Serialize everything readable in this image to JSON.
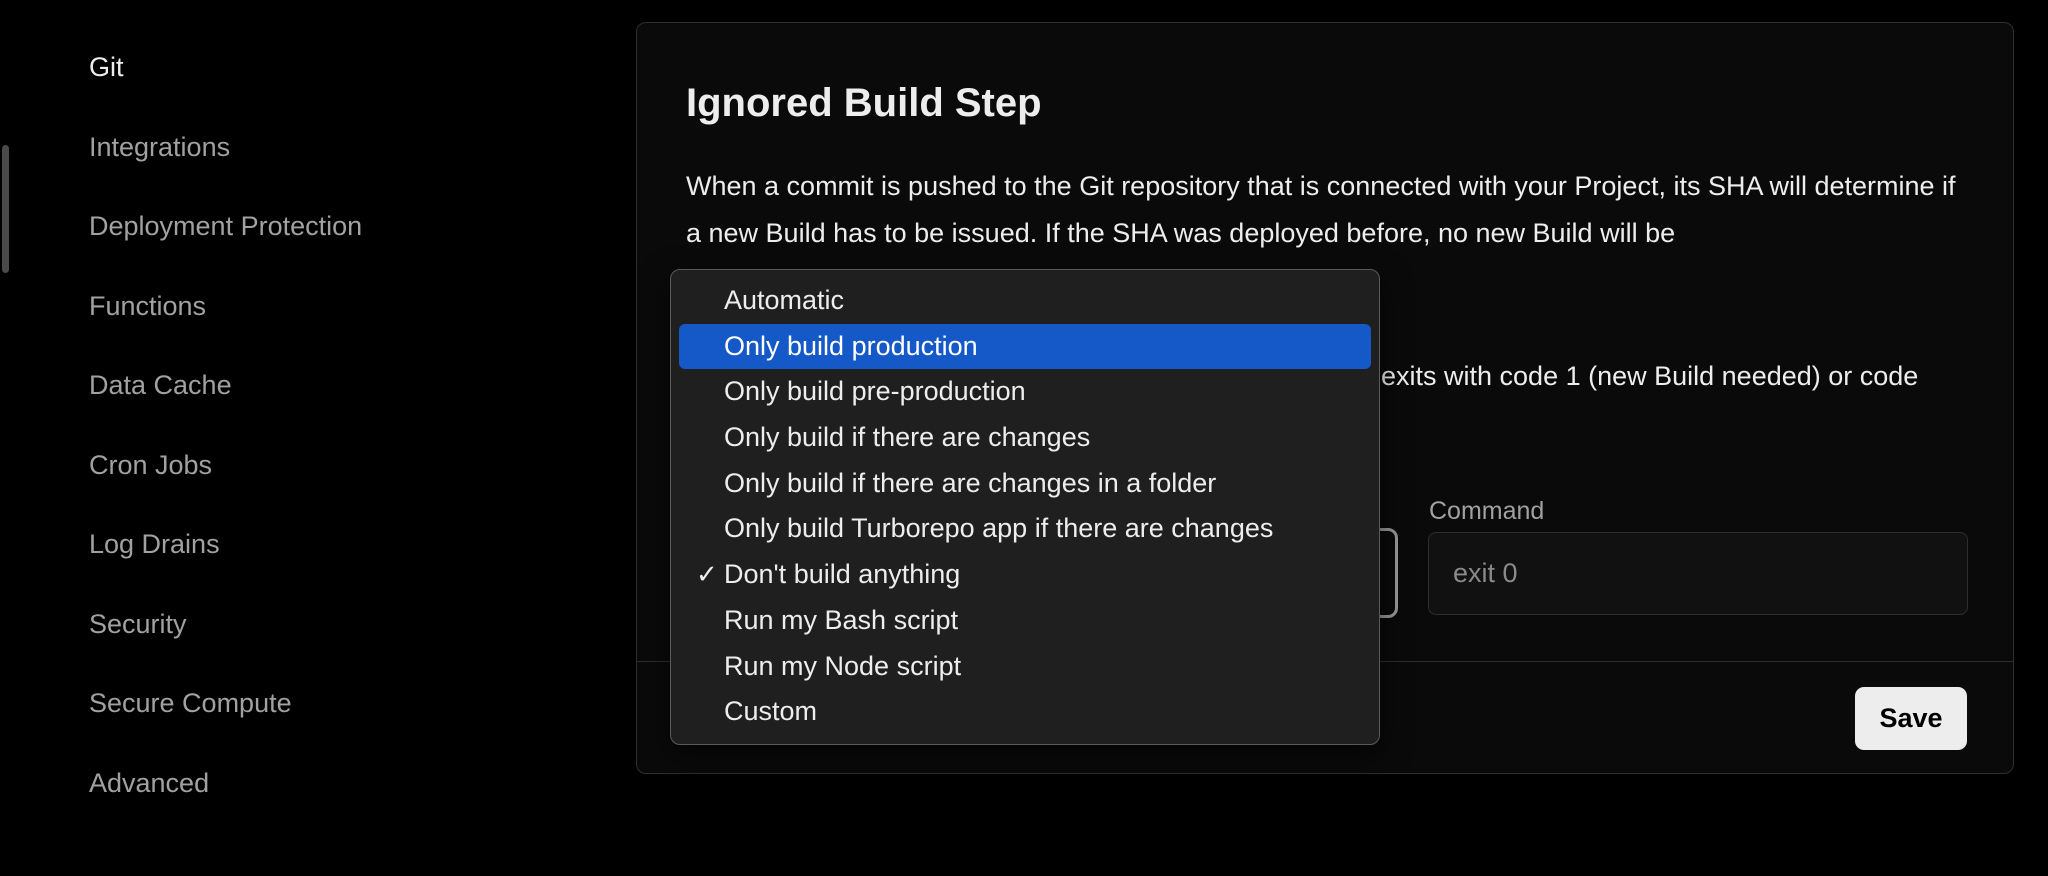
{
  "sidebar": {
    "items": [
      {
        "label": "Git",
        "active": true
      },
      {
        "label": "Integrations"
      },
      {
        "label": "Deployment Protection"
      },
      {
        "label": "Functions"
      },
      {
        "label": "Data Cache"
      },
      {
        "label": "Cron Jobs"
      },
      {
        "label": "Log Drains"
      },
      {
        "label": "Security"
      },
      {
        "label": "Secure Compute"
      },
      {
        "label": "Advanced"
      }
    ]
  },
  "card": {
    "title": "Ignored Build Step",
    "description_line1": "When a commit is pushed to the Git repository that is connected with your Project, its SHA will determine if a new Build has to be issued. If the SHA was deployed before, no new Build will be",
    "description_line2_visible": "exits with code 1 (new Build needed) or code",
    "command_label": "Command",
    "command_placeholder": "exit 0",
    "save_label": "Save"
  },
  "dropdown": {
    "options": [
      {
        "label": "Automatic"
      },
      {
        "label": "Only build production",
        "highlighted": true
      },
      {
        "label": "Only build pre-production"
      },
      {
        "label": "Only build if there are changes"
      },
      {
        "label": "Only build if there are changes in a folder"
      },
      {
        "label": "Only build Turborepo app if there are changes"
      },
      {
        "label": "Don't build anything",
        "selected": true
      },
      {
        "label": "Run my Bash script"
      },
      {
        "label": "Run my Node script"
      },
      {
        "label": "Custom"
      }
    ],
    "check_glyph": "✓"
  },
  "colors": {
    "background": "#000000",
    "text": "#ededed",
    "muted": "#a1a1a1",
    "highlight": "#1558c7"
  }
}
